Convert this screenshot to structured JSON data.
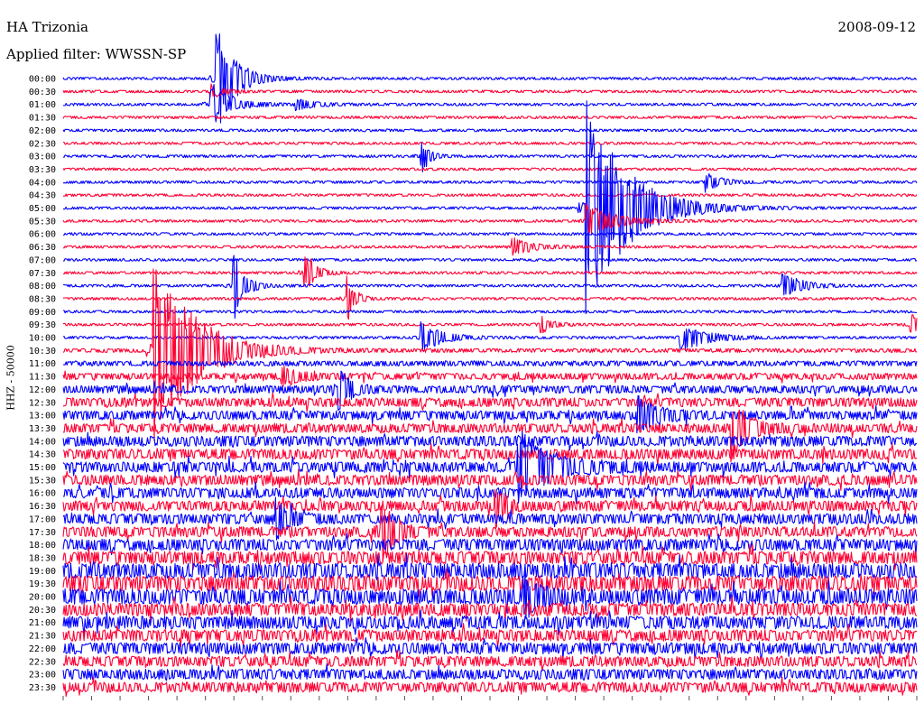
{
  "header": {
    "station": "HA Trizonia",
    "date": "2008-09-12",
    "filter_label": "Applied filter: WWSSN-SP"
  },
  "chart_data": {
    "type": "line",
    "title": "HA Trizonia",
    "subtitle": "Applied filter: WWSSN-SP",
    "ylabel": "HHZ - 50000",
    "xlabel": "",
    "grid": false,
    "legend": "none",
    "row_labels": [
      "00:00",
      "00:30",
      "01:00",
      "01:30",
      "02:00",
      "02:30",
      "03:00",
      "03:30",
      "04:00",
      "04:30",
      "05:00",
      "05:30",
      "06:00",
      "06:30",
      "07:00",
      "07:30",
      "08:00",
      "08:30",
      "09:00",
      "09:30",
      "10:00",
      "10:30",
      "11:00",
      "11:30",
      "12:00",
      "12:30",
      "13:00",
      "13:30",
      "14:00",
      "14:30",
      "15:00",
      "15:30",
      "16:00",
      "16:30",
      "17:00",
      "17:30",
      "18:00",
      "18:30",
      "19:00",
      "19:30",
      "20:00",
      "20:30",
      "21:00",
      "21:30",
      "22:00",
      "22:30",
      "23:00",
      "23:30"
    ],
    "trace_colors": [
      "#0000ff",
      "#ff0033"
    ],
    "x_minutes": [
      0,
      30
    ],
    "background_noise_by_row": [
      1,
      1,
      1,
      1,
      1,
      1,
      1,
      1,
      1,
      1,
      1,
      1,
      1,
      1,
      1,
      1,
      1,
      1,
      1,
      1,
      1,
      1.5,
      2,
      2.5,
      3,
      3.5,
      3.5,
      3.5,
      4,
      4,
      4,
      4,
      4,
      4,
      4,
      4,
      4.5,
      5,
      6,
      6,
      6,
      5,
      5,
      4.5,
      4.5,
      4,
      4,
      4
    ],
    "events": [
      {
        "row": 0,
        "minute": 5.4,
        "amplitude": 60,
        "duration": 1.4
      },
      {
        "row": 1,
        "minute": 5.2,
        "amplitude": 8,
        "duration": 1.0
      },
      {
        "row": 2,
        "minute": 5.2,
        "amplitude": 25,
        "duration": 1.5
      },
      {
        "row": 2,
        "minute": 8.2,
        "amplitude": 6,
        "duration": 1.5
      },
      {
        "row": 6,
        "minute": 12.6,
        "amplitude": 20,
        "duration": 0.6
      },
      {
        "row": 8,
        "minute": 22.6,
        "amplitude": 10,
        "duration": 1.2
      },
      {
        "row": 10,
        "minute": 18.4,
        "amplitude": 120,
        "duration": 3.0
      },
      {
        "row": 11,
        "minute": 18.4,
        "amplitude": 20,
        "duration": 2.0
      },
      {
        "row": 13,
        "minute": 15.8,
        "amplitude": 10,
        "duration": 1.5
      },
      {
        "row": 15,
        "minute": 8.5,
        "amplitude": 25,
        "duration": 0.8
      },
      {
        "row": 16,
        "minute": 6.0,
        "amplitude": 40,
        "duration": 0.8
      },
      {
        "row": 16,
        "minute": 25.3,
        "amplitude": 14,
        "duration": 1.5
      },
      {
        "row": 17,
        "minute": 10.0,
        "amplitude": 25,
        "duration": 0.6
      },
      {
        "row": 19,
        "minute": 16.8,
        "amplitude": 10,
        "duration": 0.8
      },
      {
        "row": 19,
        "minute": 29.8,
        "amplitude": 12,
        "duration": 1.0
      },
      {
        "row": 20,
        "minute": 12.6,
        "amplitude": 18,
        "duration": 1.5
      },
      {
        "row": 20,
        "minute": 21.7,
        "amplitude": 16,
        "duration": 2.0
      },
      {
        "row": 21,
        "minute": 3.2,
        "amplitude": 110,
        "duration": 3.0
      },
      {
        "row": 23,
        "minute": 7.7,
        "amplitude": 10,
        "duration": 1.5
      },
      {
        "row": 24,
        "minute": 9.7,
        "amplitude": 25,
        "duration": 0.8
      },
      {
        "row": 26,
        "minute": 20.2,
        "amplitude": 20,
        "duration": 1.5
      },
      {
        "row": 27,
        "minute": 23.5,
        "amplitude": 35,
        "duration": 1.2
      },
      {
        "row": 30,
        "minute": 16.0,
        "amplitude": 40,
        "duration": 2.5
      },
      {
        "row": 33,
        "minute": 15.2,
        "amplitude": 20,
        "duration": 0.8
      },
      {
        "row": 34,
        "minute": 7.5,
        "amplitude": 20,
        "duration": 1.0
      },
      {
        "row": 35,
        "minute": 11.2,
        "amplitude": 35,
        "duration": 1.0
      },
      {
        "row": 40,
        "minute": 16.2,
        "amplitude": 25,
        "duration": 1.0
      }
    ]
  }
}
